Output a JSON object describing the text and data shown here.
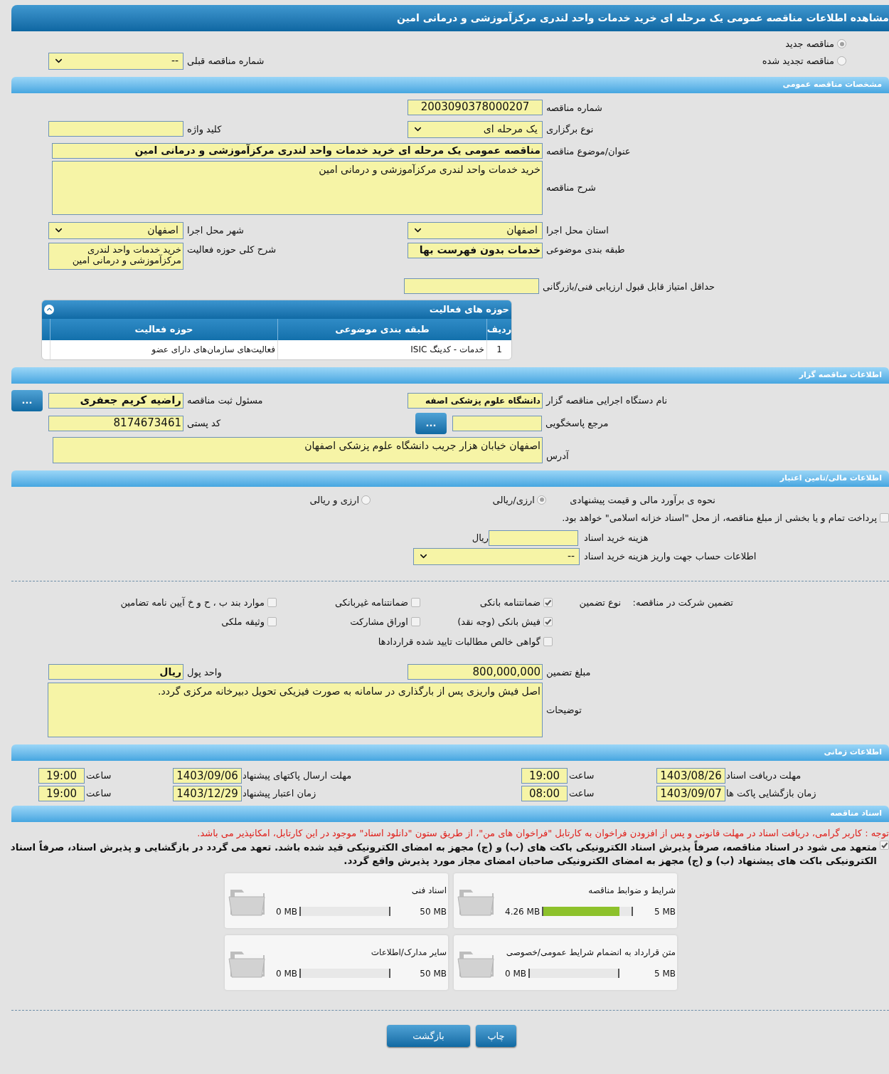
{
  "title": "مشاهده اطلاعات مناقصه عمومی یک مرحله ای خرید خدمات واحد لندری مرکزآموزشی و درمانی امین",
  "tender_kind": [
    {
      "label": "مناقصه جدید",
      "selected": true
    },
    {
      "label": "مناقصه تجدید شده",
      "selected": false
    }
  ],
  "previous_tender": {
    "label": "شماره مناقصه قبلی",
    "value": "--"
  },
  "general": {
    "heading": "مشخصات مناقصه عمومی",
    "tender_number": {
      "label": "شماره مناقصه",
      "value": "2003090378000207"
    },
    "holding_type": {
      "label": "نوع برگزاری",
      "value": "یک مرحله ای"
    },
    "keyword": {
      "label": "کلید واژه"
    },
    "subject": {
      "label": "عنوان/موضوع مناقصه",
      "value": "مناقصه عمومی یک مرحله ای خرید خدمات واحد لندری مرکزآموزشی و درمانی امین"
    },
    "description": {
      "label": "شرح مناقصه",
      "value": "خرید خدمات واحد لندری مرکزآموزشی و درمانی امین"
    },
    "province": {
      "label": "استان محل اجرا",
      "value": "اصفهان"
    },
    "city": {
      "label": "شهر محل اجرا",
      "value": "اصفهان"
    },
    "classification": {
      "label": "طبقه بندی موضوعی",
      "value": "خدمات بدون فهرست بها"
    },
    "activity_summary": {
      "label": "شرح کلی حوزه فعالیت",
      "value": "خرید خدمات واحد لندری مرکزآموزشی و درمانی امین"
    },
    "min_score": {
      "label": "حداقل امتیاز قابل قبول ارزیابی فنی/بازرگانی"
    },
    "activities": {
      "title": "حوزه های فعالیت",
      "columns": [
        "ردیف",
        "طبقه بندی موضوعی",
        "حوزه فعالیت"
      ],
      "rows": [
        [
          "1",
          "خدمات - کدینگ ISIC",
          "فعالیت‌های سازمان‌های دارای عضو"
        ]
      ]
    }
  },
  "organizer": {
    "heading": "اطلاعات مناقصه گزار",
    "organization": {
      "label": "نام دستگاه اجرایی مناقصه گزار",
      "value": "دانشگاه علوم پزشکی اصفه"
    },
    "registrar": {
      "label": "مسئول ثبت مناقصه",
      "value": "راضیه کریم جعفری",
      "button": "..."
    },
    "reference": {
      "label": "مرجع پاسخگویی",
      "button": "..."
    },
    "postal_code": {
      "label": "کد پستی",
      "value": "8174673461"
    },
    "address": {
      "label": "آدرس",
      "value": "اصفهان خیابان هزار جریب دانشگاه علوم پزشکی اصفهان"
    }
  },
  "finance": {
    "heading": "اطلاعات مالی/تامین اعتبار",
    "estimate": {
      "label": "نحوه ی برآورد مالی و قیمت پیشنهادی",
      "options": [
        {
          "label": "ارزی/ریالی",
          "selected": true
        },
        {
          "label": "ارزی و ریالی",
          "selected": false
        }
      ]
    },
    "treasury": {
      "label": "پرداخت تمام و یا بخشی از مبلغ مناقصه، از محل \"اسناد خزانه اسلامی\" خواهد بود.",
      "checked": false
    },
    "doc_fee": {
      "label": "هزینه خرید اسناد",
      "unit": "ریال"
    },
    "account": {
      "label": "اطلاعات حساب جهت واریز هزینه خرید اسناد",
      "value": "--"
    }
  },
  "guarantee": {
    "title": "تضمین شرکت در مناقصه:",
    "type_label": "نوع تضمین",
    "options": [
      {
        "label": "ضمانتنامه بانکی",
        "checked": true
      },
      {
        "label": "ضمانتنامه غیربانکی",
        "checked": false
      },
      {
        "label": "موارد بند ب ، ح و خ آیین نامه تضامین",
        "checked": false
      },
      {
        "label": "فیش بانکی (وجه نقد)",
        "checked": true
      },
      {
        "label": "اوراق مشارکت",
        "checked": false
      },
      {
        "label": "وثیقه ملکی",
        "checked": false
      },
      {
        "label": "گواهی خالص مطالبات تایید شده قراردادها",
        "checked": false
      }
    ],
    "amount": {
      "label": "مبلغ تضمین",
      "value": "800,000,000"
    },
    "currency": {
      "label": "واحد پول",
      "value": "ریال"
    },
    "notes": {
      "label": "توضیحات",
      "value": "اصل فیش واریزی پس از بارگذاری در سامانه به صورت فیزیکی تحویل دبیرخانه مرکزی گردد."
    }
  },
  "timing": {
    "heading": "اطلاعات زمانی",
    "rows": [
      [
        {
          "label": "مهلت دریافت اسناد",
          "date": "1403/08/26",
          "time_label": "ساعت",
          "time": "19:00"
        },
        {
          "label": "مهلت ارسال پاکتهای پیشنهاد",
          "date": "1403/09/06",
          "time_label": "ساعت",
          "time": "19:00"
        }
      ],
      [
        {
          "label": "زمان بازگشایی پاکت ها",
          "date": "1403/09/07",
          "time_label": "ساعت",
          "time": "08:00"
        },
        {
          "label": "زمان اعتبار پیشنهاد",
          "date": "1403/12/29",
          "time_label": "ساعت",
          "time": "19:00"
        }
      ]
    ]
  },
  "documents": {
    "heading": "اسناد مناقصه",
    "notice": "توجه : کاربر گرامی، دریافت اسناد در مهلت قانونی و پس از افزودن فراخوان به کارتابل \"فراخوان های من\"، از طریق ستون \"دانلود اسناد\" موجود در این کارتابل، امکانپذیر می باشد.",
    "pledge": {
      "text": "متعهد می شود در اسناد مناقصه، صرفاً پذیرش اسناد الکترونیکی باکت های (ب) و (ج) مجهز به امضای الکترونیکی قید شده باشد. تعهد می گردد در بازگشایی و پذیرش اسناد، صرفاً اسناد الکترونیکی باکت های پیشنهاد (ب) و (ج) مجهز به امضای الکترونیکی صاحبان امضای مجاز مورد پذیرش واقع گردد.",
      "checked": true
    },
    "files": [
      {
        "title": "شرایط و ضوابط مناقصه",
        "used": "4.26 MB",
        "max": "5 MB",
        "level": 0.852
      },
      {
        "title": "اسناد فنی",
        "used": "0 MB",
        "max": "50 MB",
        "level": 0
      },
      {
        "title": "متن قرارداد به انضمام شرایط عمومی/خصوصی",
        "used": "0 MB",
        "max": "5 MB",
        "level": 0
      },
      {
        "title": "سایر مدارک/اطلاعات",
        "used": "0 MB",
        "max": "50 MB",
        "level": 0
      }
    ]
  },
  "buttons": [
    "چاپ",
    "بازگشت"
  ]
}
